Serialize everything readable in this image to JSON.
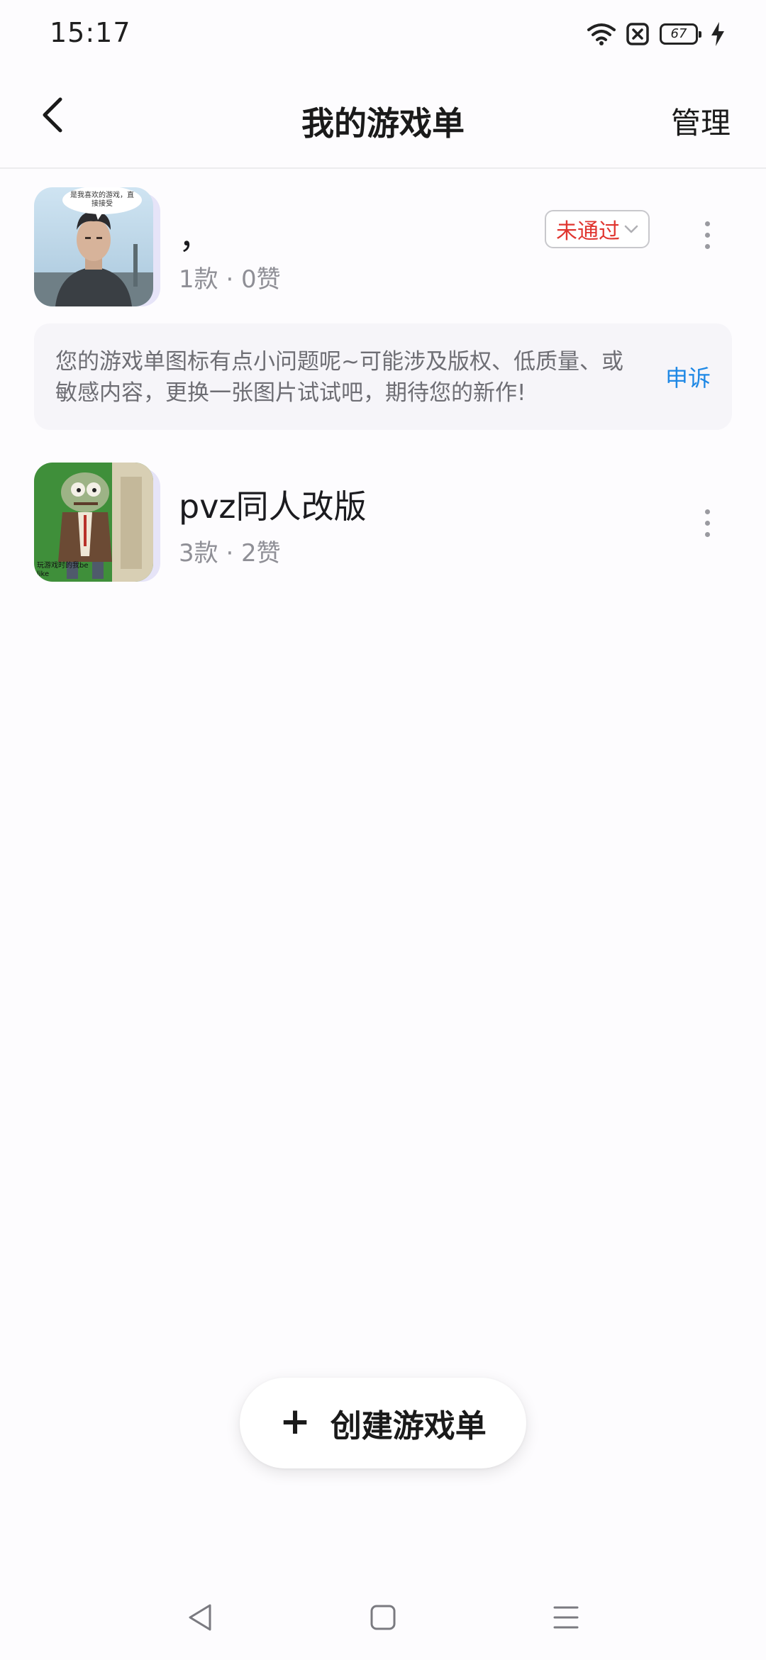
{
  "status_bar": {
    "time": "15:17",
    "battery_level": "67",
    "icons": [
      "wifi-icon",
      "sim-off-icon",
      "battery-icon",
      "charging-icon"
    ]
  },
  "header": {
    "title": "我的游戏单",
    "manage_label": "管理",
    "back_icon": "chevron-left-icon"
  },
  "playlists": [
    {
      "title": "，",
      "meta": "1款 · 0赞",
      "cover_caption": "是我喜欢的游戏，直接接受",
      "status": "未通过",
      "notice": "您的游戏单图标有点小问题呢~可能涉及版权、低质量、或敏感内容，更换一张图片试试吧，期待您的新作!",
      "appeal_label": "申诉"
    },
    {
      "title": "pvz同人改版",
      "meta": "3款 · 2赞",
      "cover_caption": "玩游戏时的我be like"
    }
  ],
  "create_button": {
    "label": "创建游戏单",
    "icon": "plus-icon"
  },
  "nav_bar": [
    "back-triangle-icon",
    "home-square-icon",
    "menu-lines-icon"
  ],
  "colors": {
    "background": "#fdfcfe",
    "rejected_red": "#e0352f",
    "link_blue": "#1e88e5"
  }
}
